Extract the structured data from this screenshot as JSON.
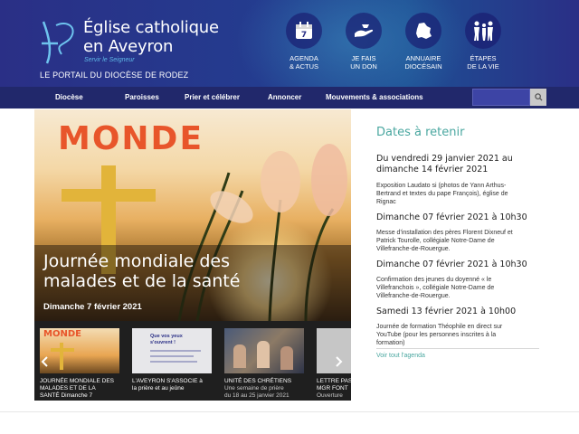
{
  "site": {
    "title_line1": "Église catholique",
    "title_line2": "en Aveyron",
    "tagline": "Servir le Seigneur",
    "portal": "LE PORTAIL DU DIOCÈSE DE RODEZ"
  },
  "header_nav": [
    {
      "line1": "AGENDA",
      "line2": "& ACTUS",
      "icon": "calendar-icon",
      "calendar_day": "7"
    },
    {
      "line1": "JE FAIS",
      "line2": "UN DON",
      "icon": "giving-hand-icon"
    },
    {
      "line1": "ANNUAIRE",
      "line2": "DIOCÉSAIN",
      "icon": "map-icon"
    },
    {
      "line1": "ÉTAPES",
      "line2": "DE LA VIE",
      "icon": "family-icon"
    }
  ],
  "menu": [
    "Diocèse",
    "Paroisses",
    "Prier et célébrer",
    "Annoncer",
    "Mouvements & associations"
  ],
  "search": {
    "placeholder": ""
  },
  "hero": {
    "word": "MONDE",
    "title_line1": "Journée mondiale des",
    "title_line2": "malades et de la santé",
    "date": "Dimanche 7 février 2021"
  },
  "carousel": [
    {
      "line1": "JOURNÉE MONDIALE DES",
      "line2": "MALADES ET DE LA",
      "line3": "SANTÉ Dimanche 7",
      "thumb_word": "MONDE"
    },
    {
      "line1": "L'AVEYRON S'ASSOCIE à",
      "line2": "la prière et au jeûne",
      "line3": "",
      "thumb_word": "Que vos yeux s'ouvrent !"
    },
    {
      "line1": "UNITÉ DES CHRÉTIENS",
      "line2": "Une semaine de prière",
      "line3": "du 18 au 25 janvier 2021",
      "thumb_word": ""
    },
    {
      "line1": "LETTRE PAS",
      "line2": "MGR FONT",
      "line3": "Ouverture",
      "thumb_word": ""
    }
  ],
  "sidebar": {
    "title": "Dates à retenir",
    "events": [
      {
        "date_line1": "Du vendredi 29 janvier 2021 au",
        "date_line2": "dimanche 14 février 2021",
        "desc_line1": "Exposition Laudato si (photos de Yann Arthus-",
        "desc_line2": "Bertrand et textes du pape François), église de",
        "desc_line3": "Rignac"
      },
      {
        "date_line1": "Dimanche 07 février 2021 à 10h30",
        "date_line2": "",
        "desc_line1": "Messe d'installation des pères Florent Dixneuf et",
        "desc_line2": "Patrick Tourolle, collégiale Notre-Dame de",
        "desc_line3": "Villefranche-de-Rouergue."
      },
      {
        "date_line1": "Dimanche 07 février 2021 à 10h30",
        "date_line2": "",
        "desc_line1": "Confirmation des jeunes du doyenné « le",
        "desc_line2": "Villefranchois », collégiale Notre-Dame de",
        "desc_line3": "Villefranche-de-Rouergue."
      },
      {
        "date_line1": "Samedi 13 février 2021 à 10h00",
        "date_line2": "",
        "desc_line1": "Journée de formation Théophile en direct sur",
        "desc_line2": "YouTube (pour les personnes inscrites à la",
        "desc_line3": "formation)"
      }
    ],
    "agenda_link": "Voir tout l'agenda"
  },
  "colors": {
    "header": "#2a2f86",
    "menu": "#21286b",
    "accent": "#4aa7a0",
    "hero_word": "#e8552a"
  }
}
